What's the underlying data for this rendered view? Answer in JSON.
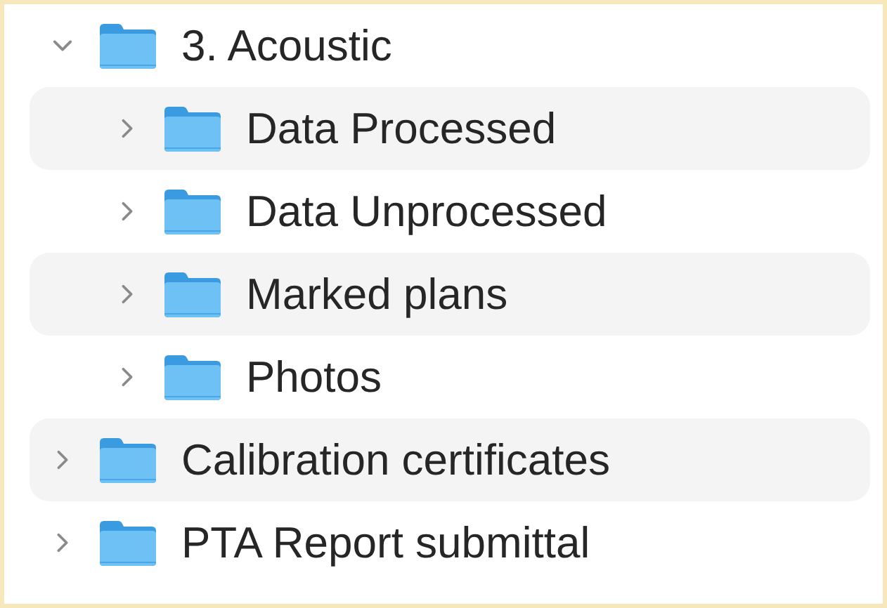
{
  "tree": [
    {
      "label": "3. Acoustic",
      "expanded": true,
      "children": [
        {
          "label": "Data Processed",
          "expanded": false
        },
        {
          "label": "Data Unprocessed",
          "expanded": false
        },
        {
          "label": "Marked plans",
          "expanded": false
        },
        {
          "label": "Photos",
          "expanded": false
        }
      ]
    },
    {
      "label": "Calibration certificates",
      "expanded": false
    },
    {
      "label": "PTA Report submittal",
      "expanded": false
    }
  ]
}
